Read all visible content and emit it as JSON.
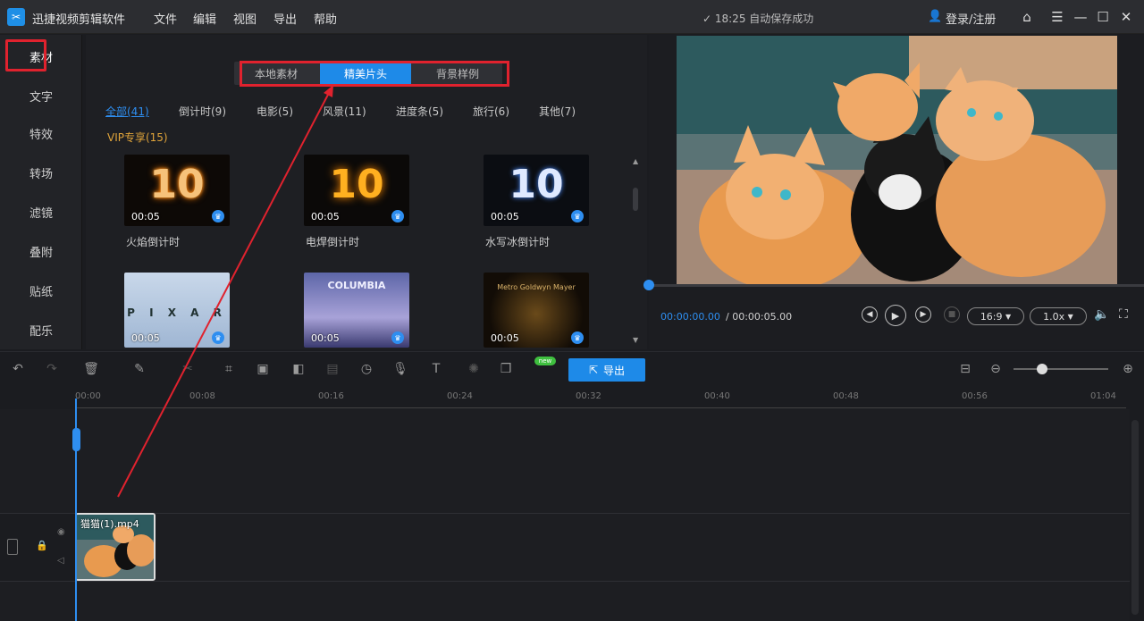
{
  "app": {
    "title": "迅捷视频剪辑软件",
    "menus": [
      "文件",
      "编辑",
      "视图",
      "导出",
      "帮助"
    ],
    "save_status": "✓ 18:25 自动保存成功",
    "login": "登录/注册"
  },
  "sidebar": {
    "items": [
      "素材",
      "文字",
      "特效",
      "转场",
      "滤镜",
      "叠附",
      "贴纸",
      "配乐"
    ],
    "active": "素材"
  },
  "media": {
    "tabs": [
      "本地素材",
      "精美片头",
      "背景样例"
    ],
    "active_tab": "精美片头",
    "categories": [
      "全部(41)",
      "倒计时(9)",
      "电影(5)",
      "风景(11)",
      "进度条(5)",
      "旅行(6)",
      "其他(7)"
    ],
    "active_category": "全部(41)",
    "vip_label": "VIP专享(15)",
    "cards": [
      {
        "title": "火焰倒计时",
        "duration": "00:05",
        "thumb_text": "10"
      },
      {
        "title": "电焊倒计时",
        "duration": "00:05",
        "thumb_text": "10"
      },
      {
        "title": "水写冰倒计时",
        "duration": "00:05",
        "thumb_text": "10"
      },
      {
        "title": "",
        "duration": "00:05",
        "thumb_text": "P I X A R"
      },
      {
        "title": "",
        "duration": "00:05",
        "thumb_text": "COLUMBIA"
      },
      {
        "title": "",
        "duration": "00:05",
        "thumb_text": "Metro Goldwyn Mayer"
      }
    ]
  },
  "preview": {
    "current_time": "00:00:00.00",
    "total_time": "/ 00:00:05.00",
    "aspect_ratio": "16:9",
    "speed": "1.0x"
  },
  "toolbar": {
    "export_label": "导出",
    "new_badge": "new"
  },
  "timeline": {
    "ruler_ticks": [
      "00:00",
      "00:08",
      "00:16",
      "00:24",
      "00:32",
      "00:40",
      "00:48",
      "00:56",
      "01:04"
    ],
    "clip_label": "猫猫(1).mp4"
  },
  "colors": {
    "accent": "#1e8ae8",
    "highlight_red": "#e0222e"
  }
}
